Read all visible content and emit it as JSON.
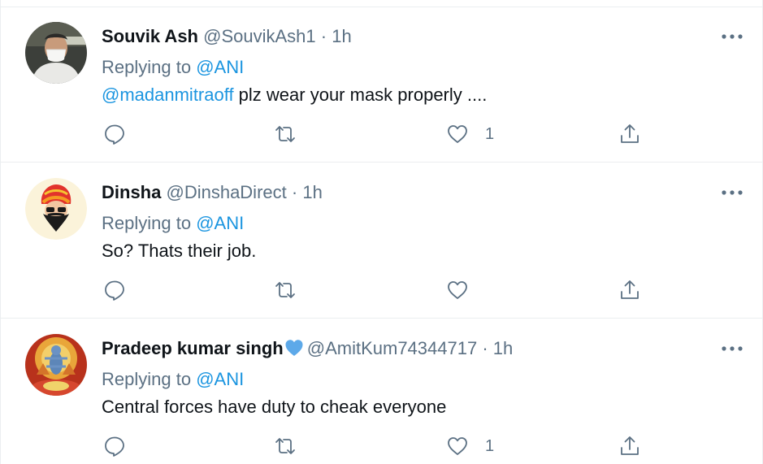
{
  "tweets": [
    {
      "name": "Souvik Ash",
      "handle": "@SouvikAsh1",
      "dot": "·",
      "time": "1h",
      "replying_prefix": "Replying to",
      "replying_to": "@ANI",
      "body_mention": "@madanmitraoff",
      "body_text": " plz wear your mask properly ....",
      "likes": "1",
      "avatar_icon": "person-with-mask-avatar"
    },
    {
      "name": "Dinsha",
      "handle": "@DinshaDirect",
      "dot": "·",
      "time": "1h",
      "replying_prefix": "Replying to",
      "replying_to": "@ANI",
      "body_mention": "",
      "body_text": "So? Thats their job.",
      "likes": "",
      "avatar_icon": "turban-cartoon-avatar"
    },
    {
      "name": "Pradeep kumar singh",
      "handle": "@AmitKum74344717",
      "dot": "·",
      "time": "1h",
      "replying_prefix": "Replying to",
      "replying_to": "@ANI",
      "body_mention": "",
      "body_text": "Central forces have duty to cheak everyone",
      "likes": "1",
      "avatar_icon": "deity-image-avatar",
      "emoji": "blue-heart-icon"
    }
  ],
  "colors": {
    "text": "#0f1419",
    "secondary": "#5b7083",
    "link": "#1b95e0",
    "divider": "#ebeef0",
    "heart_blue": "#5da9e9"
  }
}
